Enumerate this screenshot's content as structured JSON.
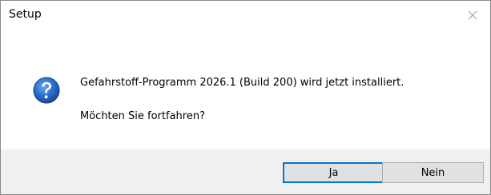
{
  "window": {
    "title": "Setup",
    "close_icon": "close-icon"
  },
  "message": {
    "icon": "question-icon",
    "line1": "Gefahrstoff-Programm 2026.1 (Build 200) wird jetzt installiert.",
    "line2": "Möchten Sie fortfahren?"
  },
  "buttons": {
    "yes_label": "Ja",
    "no_label": "Nein"
  },
  "colors": {
    "icon_blue": "#1f5fb8",
    "focus_border": "#0078d7",
    "footer_bg": "#f0f0f0"
  }
}
